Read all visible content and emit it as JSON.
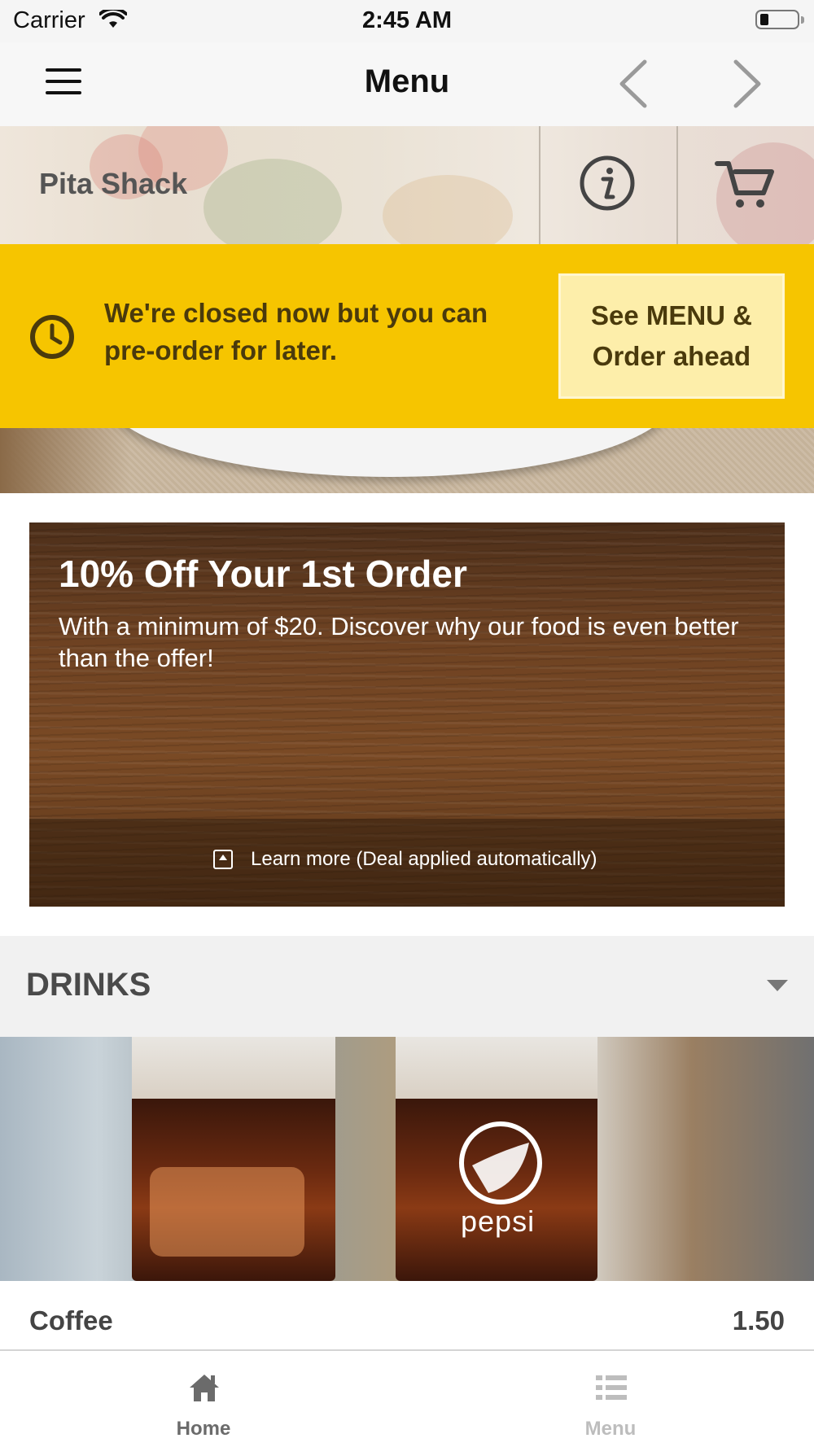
{
  "status_bar": {
    "carrier": "Carrier",
    "time": "2:45 AM"
  },
  "nav": {
    "title": "Menu",
    "menu_icon": "hamburger-icon",
    "prev_icon": "chevron-left-icon",
    "next_icon": "chevron-right-icon"
  },
  "restaurant": {
    "name": "Pita Shack",
    "info_icon": "info-icon",
    "cart_icon": "cart-icon"
  },
  "closed_banner": {
    "message": "We're closed now but you can pre-order for later.",
    "button_line1": "See MENU &",
    "button_line2": "Order ahead",
    "icon": "clock-icon",
    "background": "#f6c500"
  },
  "deal": {
    "title": "10% Off Your 1st Order",
    "description": "With a minimum of $20. Discover why our food is even better than the offer!",
    "learn_more": "Learn more (Deal applied automatically)"
  },
  "section": {
    "title": "DRINKS",
    "icon": "chevron-down-icon"
  },
  "drinks_image": {
    "brand_text": "pepsi"
  },
  "items": [
    {
      "name": "Coffee",
      "price": "1.50"
    }
  ],
  "tabs": [
    {
      "label": "Home",
      "icon": "home-icon",
      "active": true
    },
    {
      "label": "Menu",
      "icon": "list-icon",
      "active": false
    }
  ]
}
